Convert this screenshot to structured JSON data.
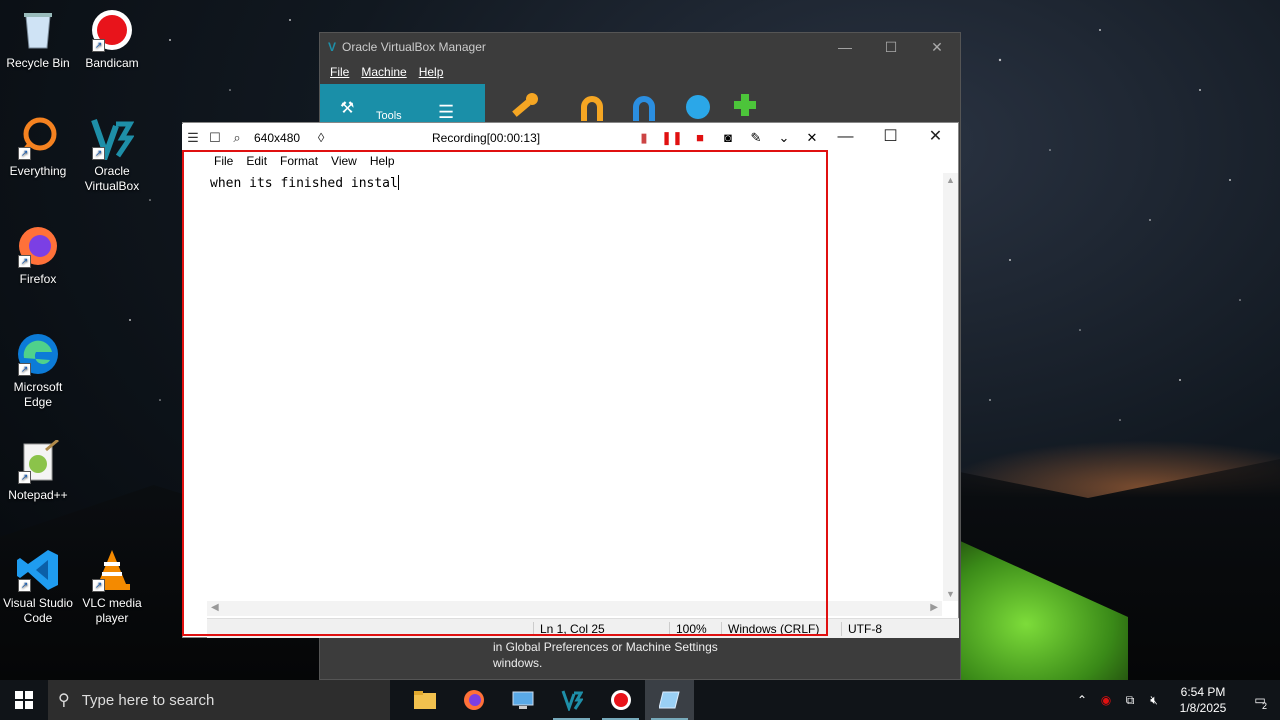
{
  "desktop": {
    "icons": [
      {
        "label": "Recycle Bin"
      },
      {
        "label": "Bandicam"
      },
      {
        "label": "Everything"
      },
      {
        "label": "Oracle VirtualBox"
      },
      {
        "label": "Firefox"
      },
      {
        "label": "Microsoft Edge"
      },
      {
        "label": "Notepad++"
      },
      {
        "label": "Visual Studio Code"
      },
      {
        "label": "VLC media player"
      }
    ]
  },
  "virtualbox": {
    "title": "Oracle VirtualBox Manager",
    "menu": [
      "File",
      "Machine",
      "Help"
    ],
    "tools_label": "Tools",
    "bottom_text": "in Global Preferences or Machine Settings windows."
  },
  "notepad": {
    "menu": [
      "File",
      "Edit",
      "Format",
      "View",
      "Help"
    ],
    "content": "when its finished instal",
    "status": {
      "position": "Ln 1, Col 25",
      "zoom": "100%",
      "line_ending": "Windows (CRLF)",
      "encoding": "UTF-8"
    }
  },
  "bandicam": {
    "resolution": "640x480",
    "recording_title": "Recording[00:00:13]"
  },
  "taskbar": {
    "search_placeholder": "Type here to search",
    "time": "6:54 PM",
    "date": "1/8/2025",
    "notification_count": "2"
  },
  "colors": {
    "record_frame": "#e01010",
    "vbox_tools": "#1a8fa8",
    "taskbar": "#101418"
  }
}
